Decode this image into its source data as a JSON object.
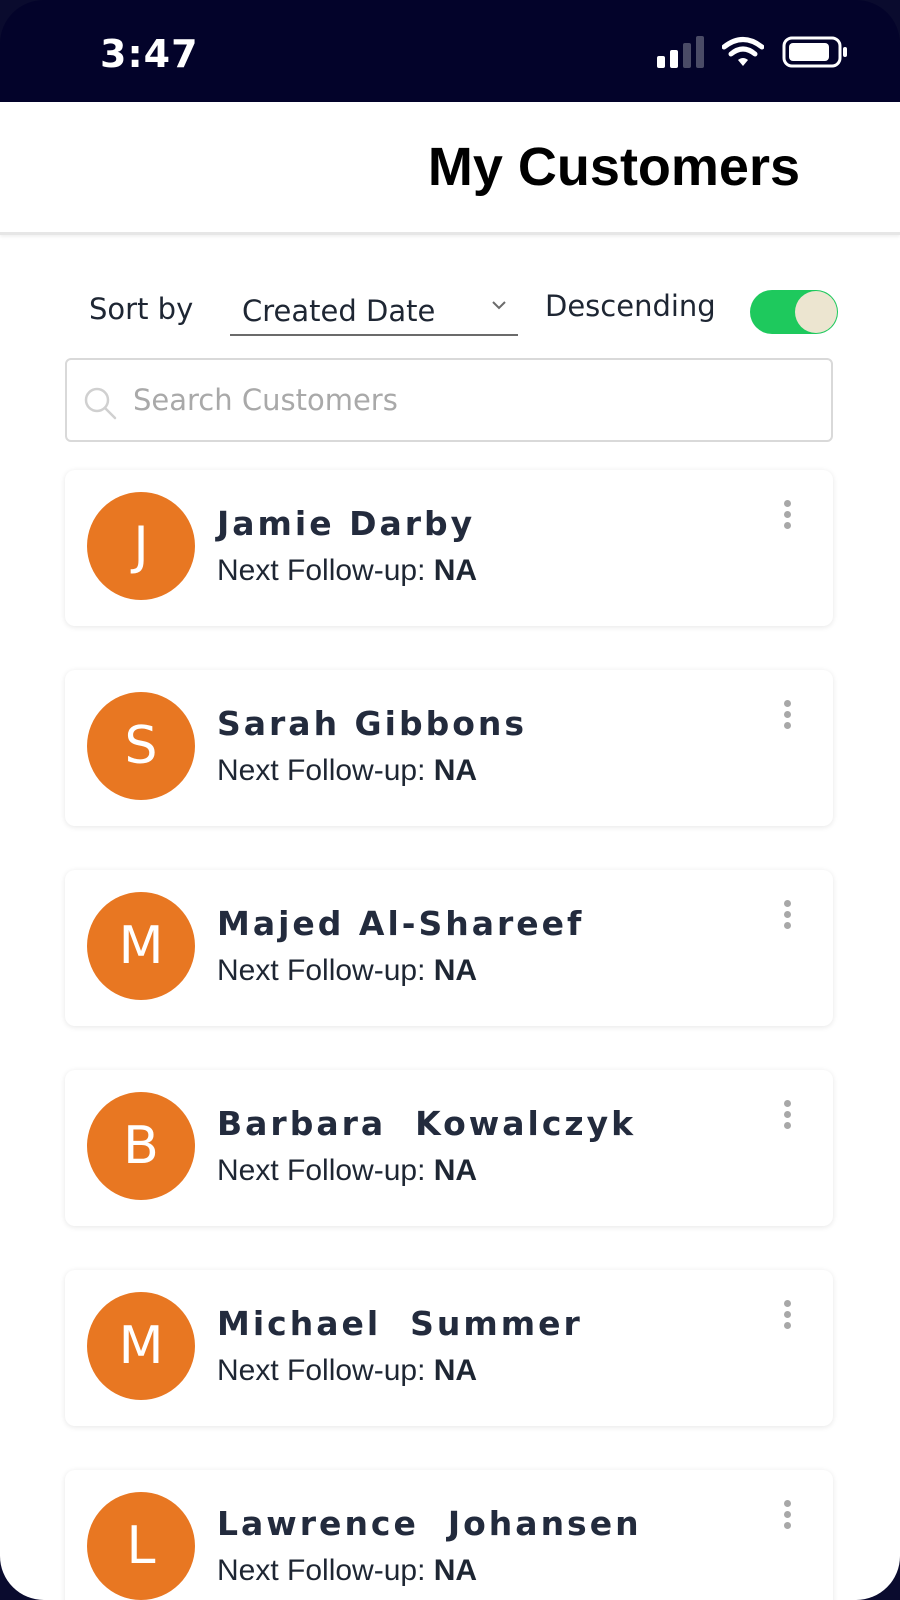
{
  "status_bar": {
    "time": "3:47"
  },
  "header": {
    "title": "My Customers"
  },
  "sort": {
    "label": "Sort by",
    "selected": "Created Date",
    "order_label": "Descending",
    "descending_on": true
  },
  "search": {
    "placeholder": "Search Customers",
    "value": ""
  },
  "followup_label": "Next Follow-up: ",
  "customers": [
    {
      "initial": "J",
      "name": "Jamie Darby",
      "followup": "NA"
    },
    {
      "initial": "S",
      "name": "Sarah Gibbons",
      "followup": "NA"
    },
    {
      "initial": "M",
      "name": "Majed Al-Shareef",
      "followup": "NA"
    },
    {
      "initial": "B",
      "name": "Barbara  Kowalczyk",
      "followup": "NA"
    },
    {
      "initial": "M",
      "name": "Michael  Summer",
      "followup": "NA"
    },
    {
      "initial": "L",
      "name": "Lawrence  Johansen",
      "followup": "NA"
    }
  ],
  "colors": {
    "avatar": "#e87722",
    "toggle_on": "#1ec95d",
    "status_bar": "#03032a"
  },
  "icons": {
    "status": [
      "cellular-signal-icon",
      "wifi-icon",
      "battery-icon"
    ],
    "search": "search-icon",
    "sort": "chevron-down-icon",
    "card_menu": "more-vertical-icon"
  }
}
